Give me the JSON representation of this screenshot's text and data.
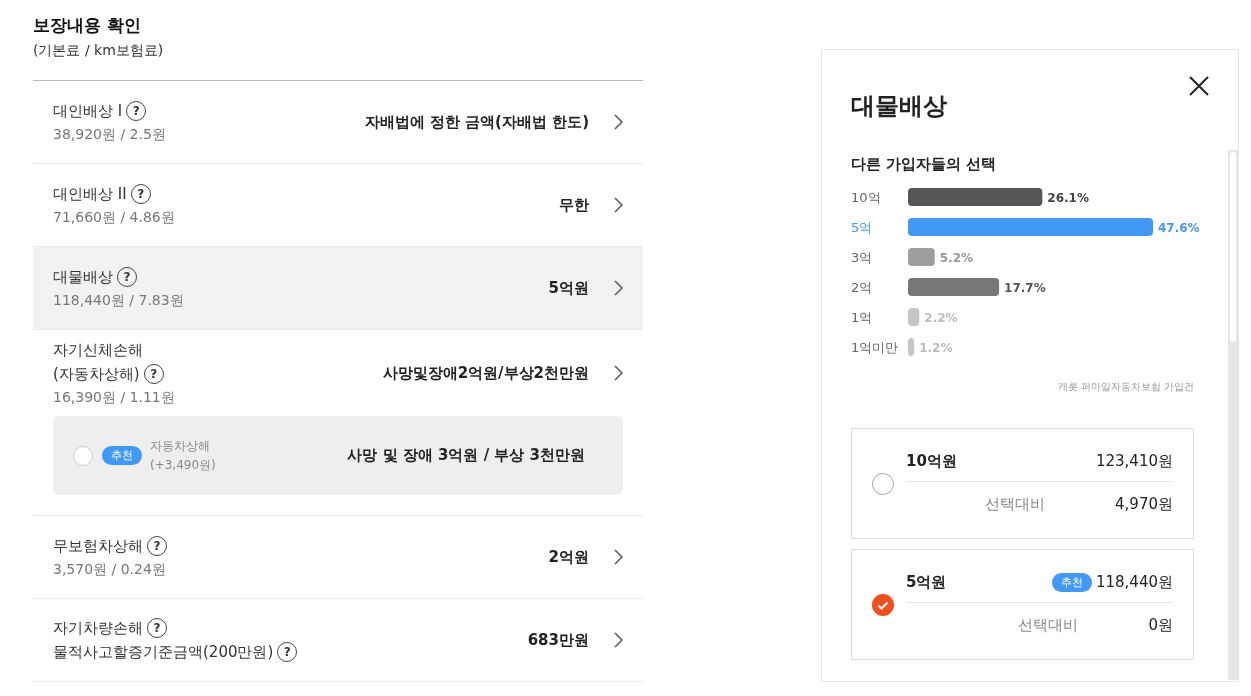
{
  "header": {
    "title": "보장내용 확인",
    "subtitle": "(기본료 / km보험료)"
  },
  "coverages": [
    {
      "name_lines": [
        {
          "text": "대인배상 I",
          "help": "?"
        }
      ],
      "price": "38,920원 / 2.5원",
      "value": "자배법에 정한 금액(자배법 한도)",
      "selected": false
    },
    {
      "name_lines": [
        {
          "text": "대인배상 II",
          "help": "?"
        }
      ],
      "price": "71,660원 / 4.86원",
      "value": "무한",
      "selected": false
    },
    {
      "name_lines": [
        {
          "text": "대물배상",
          "help": "?"
        }
      ],
      "price": "118,440원 / 7.83원",
      "value": "5억원",
      "selected": true
    },
    {
      "name_lines": [
        {
          "text": "자기신체손해"
        },
        {
          "text": "(자동차상해)",
          "help": "?"
        }
      ],
      "price": "16,390원 / 1.11원",
      "value": "사망및장애2억원/부상2천만원",
      "selected": false,
      "upgrade": {
        "checked": false,
        "badge": "추천",
        "name": "자동차상해",
        "extra": "(+3,490원)",
        "value": "사망 및 장애 3억원 / 부상 3천만원"
      }
    },
    {
      "name_lines": [
        {
          "text": "무보험차상해",
          "help": "?"
        }
      ],
      "price": "3,570원 / 0.24원",
      "value": "2억원",
      "selected": false
    },
    {
      "name_lines": [
        {
          "text": "자기차량손해",
          "help": "?"
        },
        {
          "text": "물적사고할증기준금액(200만원)",
          "help": "?"
        }
      ],
      "value": "683만원",
      "selected": false
    }
  ],
  "panel": {
    "title": "대물배상",
    "chart_title": "다른 가입자들의 선택",
    "chart_data": {
      "type": "bar",
      "orientation": "horizontal",
      "categories": [
        "10억",
        "5억",
        "3억",
        "2억",
        "1억",
        "1억미만"
      ],
      "values": [
        26.1,
        47.6,
        5.2,
        17.7,
        2.2,
        1.2
      ],
      "value_labels": [
        "26.1%",
        "47.6%",
        "5.2%",
        "17.7%",
        "2.2%",
        "1.2%"
      ]
    },
    "source": "캐롯 퍼마일자동차보험 가입건",
    "options": [
      {
        "amount": "10억원",
        "price": "123,410원",
        "diff_label": "선택대비",
        "diff": "4,970원",
        "selected": false
      },
      {
        "amount": "5억원",
        "badge": "추천",
        "price": "118,440원",
        "diff_label": "선택대비",
        "diff": "0원",
        "selected": true
      }
    ]
  }
}
